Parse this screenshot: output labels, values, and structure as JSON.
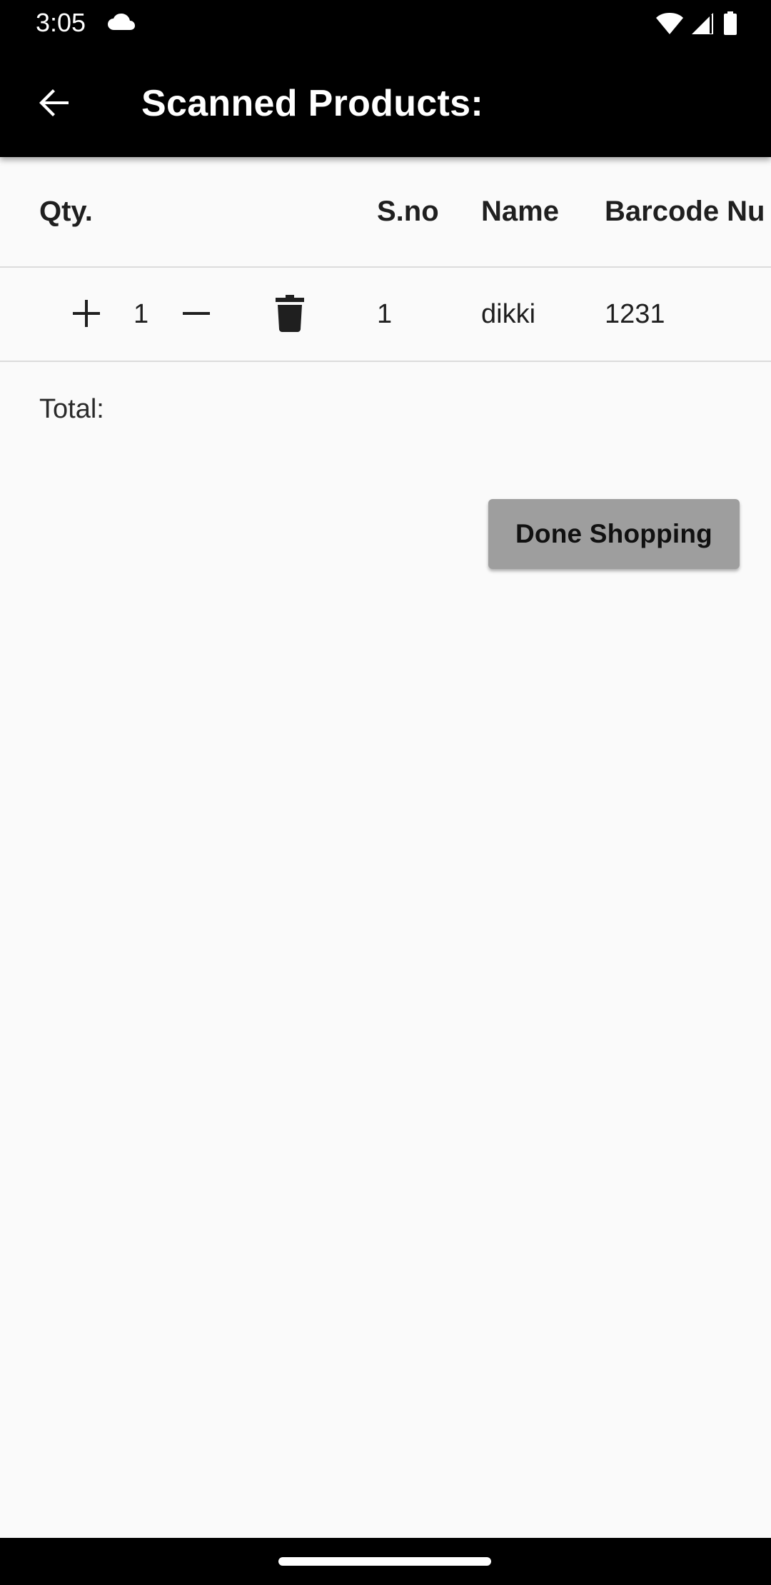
{
  "status_bar": {
    "time": "3:05",
    "icons": [
      "cloud-icon",
      "wifi-icon",
      "signal-icon",
      "battery-icon"
    ]
  },
  "app_bar": {
    "back_icon": "arrow-left-icon",
    "title": "Scanned Products:"
  },
  "table": {
    "headers": {
      "qty": "Qty.",
      "sno": "S.no",
      "name": "Name",
      "barcode": "Barcode Nu"
    },
    "rows": [
      {
        "qty": "1",
        "sno": "1",
        "name": "dikki",
        "barcode": "1231",
        "actions": [
          "plus-icon",
          "minus-icon",
          "delete-icon"
        ]
      }
    ]
  },
  "total_label": "Total:",
  "done_button_label": "Done Shopping",
  "colors": {
    "app_bar": "#000000",
    "background": "#fafafa",
    "button": "#9e9e9e",
    "divider": "#dcdcdc"
  }
}
